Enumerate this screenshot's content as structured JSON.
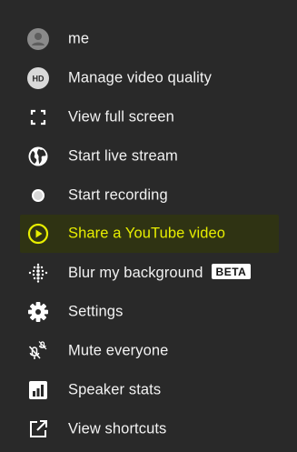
{
  "menu": {
    "items": [
      {
        "label": "me",
        "icon": "avatar-icon"
      },
      {
        "label": "Manage video quality",
        "icon": "hd-icon",
        "icon_text": "HD"
      },
      {
        "label": "View full screen",
        "icon": "fullscreen-icon"
      },
      {
        "label": "Start live stream",
        "icon": "globe-icon"
      },
      {
        "label": "Start recording",
        "icon": "record-icon"
      },
      {
        "label": "Share a YouTube video",
        "icon": "play-circle-icon",
        "highlighted": true
      },
      {
        "label": "Blur my background",
        "icon": "blur-icon",
        "badge": "BETA"
      },
      {
        "label": "Settings",
        "icon": "gear-icon"
      },
      {
        "label": "Mute everyone",
        "icon": "mute-everyone-icon"
      },
      {
        "label": "Speaker stats",
        "icon": "stats-icon"
      },
      {
        "label": "View shortcuts",
        "icon": "external-link-icon"
      }
    ]
  },
  "colors": {
    "background": "#292929",
    "text": "#f2f2f2",
    "highlight_text": "#e7ee00",
    "highlight_bg": "#2f3313"
  }
}
